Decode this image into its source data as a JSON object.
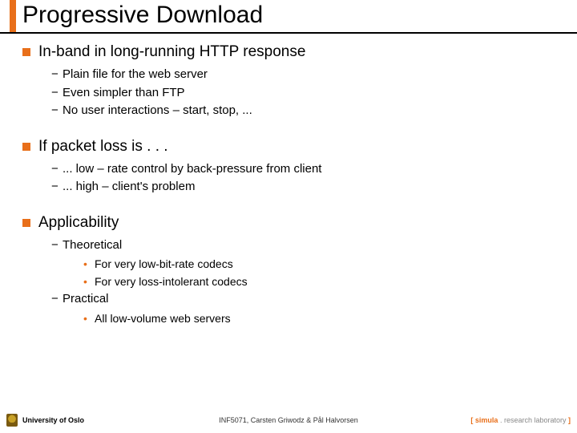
{
  "title": "Progressive Download",
  "sections": [
    {
      "title": "In-band in long-running HTTP response",
      "items": [
        "Plain file for the web server",
        "Even simpler than FTP",
        "No user interactions – start, stop, ..."
      ]
    },
    {
      "title": "If packet loss is . . .",
      "items": [
        "... low – rate control by back-pressure from client",
        "... high – client's problem"
      ]
    },
    {
      "title": "Applicability",
      "groups": [
        {
          "label": "Theoretical",
          "bullets": [
            "For very low-bit-rate codecs",
            "For very loss-intolerant codecs"
          ]
        },
        {
          "label": "Practical",
          "bullets": [
            "All low-volume web servers"
          ]
        }
      ]
    }
  ],
  "footer": {
    "left": "University of Oslo",
    "center": "INF5071, Carsten Griwodz & Pål Halvorsen",
    "right_bracket_open": "[ ",
    "right_brand": "simula",
    "right_dot": " . ",
    "right_lab": "research laboratory",
    "right_bracket_close": " ]"
  }
}
